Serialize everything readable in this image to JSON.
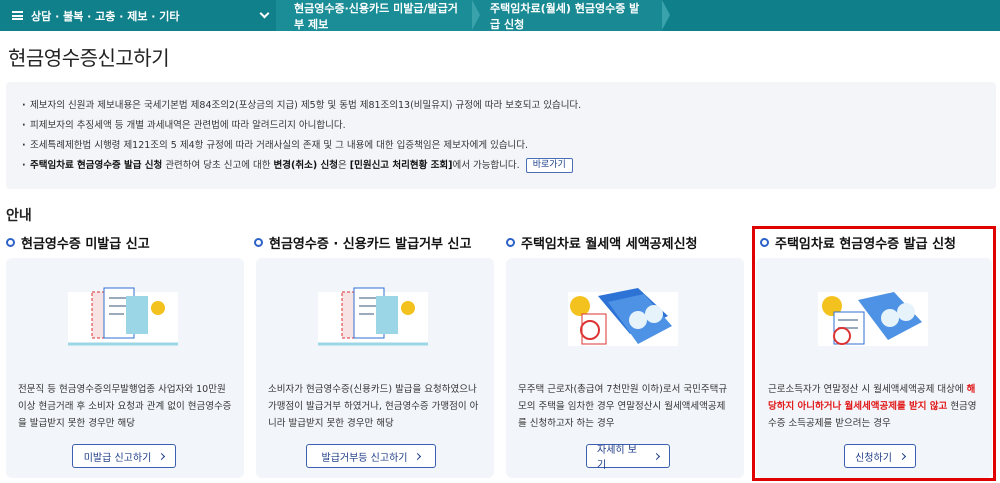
{
  "topbar": {
    "home_label": "상담 · 불복 · 고충 · 제보 · 기타",
    "crumbs": [
      "현금영수증·신용카드 미발급/발급거부 제보",
      "주택임차료(월세) 현금영수증 발급 신청"
    ]
  },
  "page": {
    "title": "현금영수증신고하기"
  },
  "notice": {
    "items": [
      "제보자의 신원과 제보내용은 국세기본법 제84조의2(포상금의 지급) 제5항 및 동법 제81조의13(비밀유지) 규정에 따라 보호되고 있습니다.",
      "피제보자의 추징세액 등 개별 과세내역은 관련법에 따라 알려드리지 아니합니다.",
      "조세특례제한법 시행령 제121조의 5 제4항 규정에 따라 거래사실의 존재 및 그 내용에 대한 입증책임은 제보자에게 있습니다."
    ],
    "last": {
      "part1": "주택임차료 현금영수증 발급 신청",
      "part2": " 관련하여 당초 신고에 대한 ",
      "part3": "변경(취소) 신청",
      "part4": "은 ",
      "part5": "[민원신고 처리현황 조회]",
      "part6": "에서 가능합니다.",
      "button": "바로가기"
    }
  },
  "section": {
    "title": "안내"
  },
  "cards": [
    {
      "title": "현금영수증 미발급 신고",
      "desc": "전문직 등 현금영수증의무발행업종 사업자와 10만원 이상 현금거래 후 소비자 요청과 관계 없이 현금영수증을 발급받지 못한 경우만 해당",
      "button": "미발급 신고하기"
    },
    {
      "title": "현금영수증 · 신용카드 발급거부 신고",
      "desc": "소비자가 현금영수증(신용카드) 발급을 요청하였으나 가맹점이 발급거부 하였거나, 현금영수증 가맹점이 아니라 발급받지 못한 경우만 해당",
      "button": "발급거부등 신고하기"
    },
    {
      "title": "주택임차료 월세액 세액공제신청",
      "desc": "무주택 근로자(총급여 7천만원 이하)로서 국민주택규모의 주택을 임차한 경우 연말정산시 월세액세액공제를 신청하고자 하는 경우",
      "button": "자세히 보기"
    },
    {
      "title": "주택임차료 현금영수증 발급 신청",
      "desc_a": "근로소득자가 연말정산 시 월세액세액공제 대상에 ",
      "desc_red": "해당하지 아니하거나 월세세액공제를 받지 않고",
      "desc_b": " 현금영수증 소득공제를 받으려는 경우",
      "button": "신청하기"
    }
  ],
  "colors": {
    "topbar": "#0f7f8a",
    "accent_ring": "#2c62c7",
    "highlight": "#e00000",
    "card_bg": "#f2f5fa"
  },
  "icons": [
    "menu-icon",
    "chevron-down-icon",
    "receipt-illustration",
    "wallet-illustration",
    "chevron-right-icon"
  ]
}
